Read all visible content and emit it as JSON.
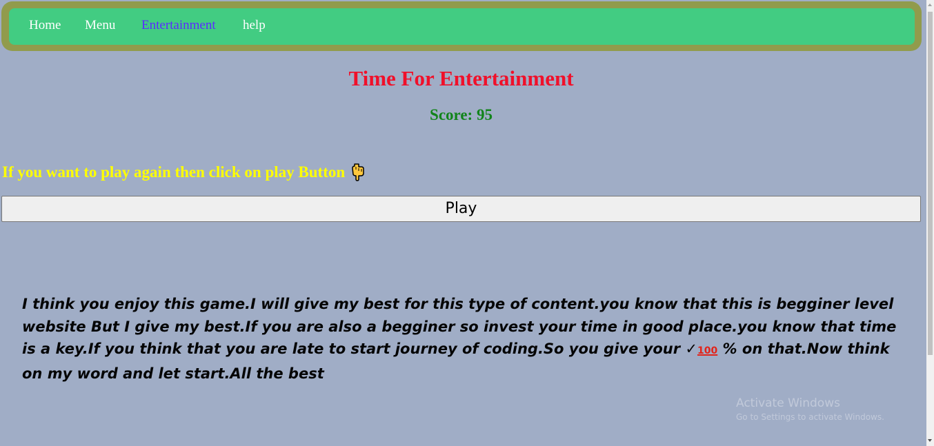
{
  "nav": {
    "items": [
      {
        "label": "Home"
      },
      {
        "label": "Menu"
      },
      {
        "label": "Entertainment"
      },
      {
        "label": "help"
      }
    ]
  },
  "main": {
    "title": "Time For Entertainment",
    "score_label": "Score: 95",
    "prompt": "If you want to play again then click on play Button",
    "pointer_icon": "backhand-index-pointing-down-icon",
    "play_label": "Play",
    "message_part1": "I think you enjoy this game.I will give my best for this type of content.you know that this is begginer level website But I give my best.If you are also a begginer so invest your time in good place.you know that time is a key.If you think that you are late to start journey of coding.So you give your ",
    "check_symbol": "✓",
    "hundred_symbol": "100",
    "message_part2": " % on that.Now think on my word and let start.All the best"
  },
  "watermark": {
    "title": "Activate Windows",
    "subtitle": "Go to Settings to activate Windows."
  },
  "colors": {
    "background": "#a0adc6",
    "nav_outer": "#919b4c",
    "nav_inner": "#42cc82",
    "nav_active": "#5b2bff",
    "title": "#f0102a",
    "score": "#11841a",
    "prompt": "#ffff00"
  }
}
